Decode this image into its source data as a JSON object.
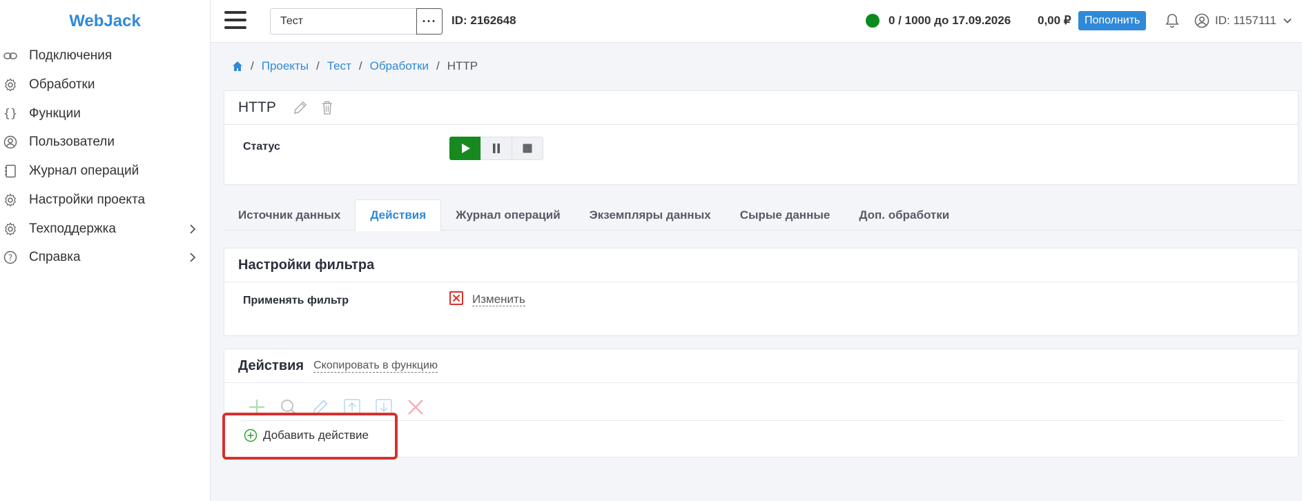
{
  "sidebar": {
    "logo": "WebJack",
    "items": [
      {
        "label": "Подключения",
        "icon": "link-icon"
      },
      {
        "label": "Обработки",
        "icon": "gear-icon"
      },
      {
        "label": "Функции",
        "icon": "braces-icon"
      },
      {
        "label": "Пользователи",
        "icon": "user-circle-icon"
      },
      {
        "label": "Журнал операций",
        "icon": "notebook-icon"
      },
      {
        "label": "Настройки проекта",
        "icon": "gear-icon"
      },
      {
        "label": "Техподдержка",
        "icon": "gear-icon",
        "expandable": true
      },
      {
        "label": "Справка",
        "icon": "question-circle-icon",
        "expandable": true
      }
    ]
  },
  "topbar": {
    "project_value": "Тест",
    "dots_label": "···",
    "project_id": "ID: 2162648",
    "quota": "0 / 1000 до 17.09.2026",
    "balance": "0,00 ₽",
    "topup_label": "Пополнить",
    "user_id": "ID: 1157111",
    "status_color": "#0a8a1f",
    "accent_color": "#2f89d8"
  },
  "breadcrumb": {
    "items": [
      "Проекты",
      "Тест",
      "Обработки"
    ],
    "current": "HTTP",
    "separator": "/"
  },
  "header_card": {
    "title": "HTTP",
    "status_label": "Статус"
  },
  "tabs": [
    {
      "label": "Источник данных",
      "active": false
    },
    {
      "label": "Действия",
      "active": true
    },
    {
      "label": "Журнал операций",
      "active": false
    },
    {
      "label": "Экземпляры данных",
      "active": false
    },
    {
      "label": "Сырые данные",
      "active": false
    },
    {
      "label": "Доп. обработки",
      "active": false
    }
  ],
  "filter_card": {
    "title": "Настройки фильтра",
    "apply_label": "Применять фильтр",
    "change_link": "Изменить"
  },
  "actions_card": {
    "title": "Действия",
    "copy_link": "Скопировать в функцию",
    "add_label": "Добавить действие"
  },
  "highlight_color": "#d7302d"
}
